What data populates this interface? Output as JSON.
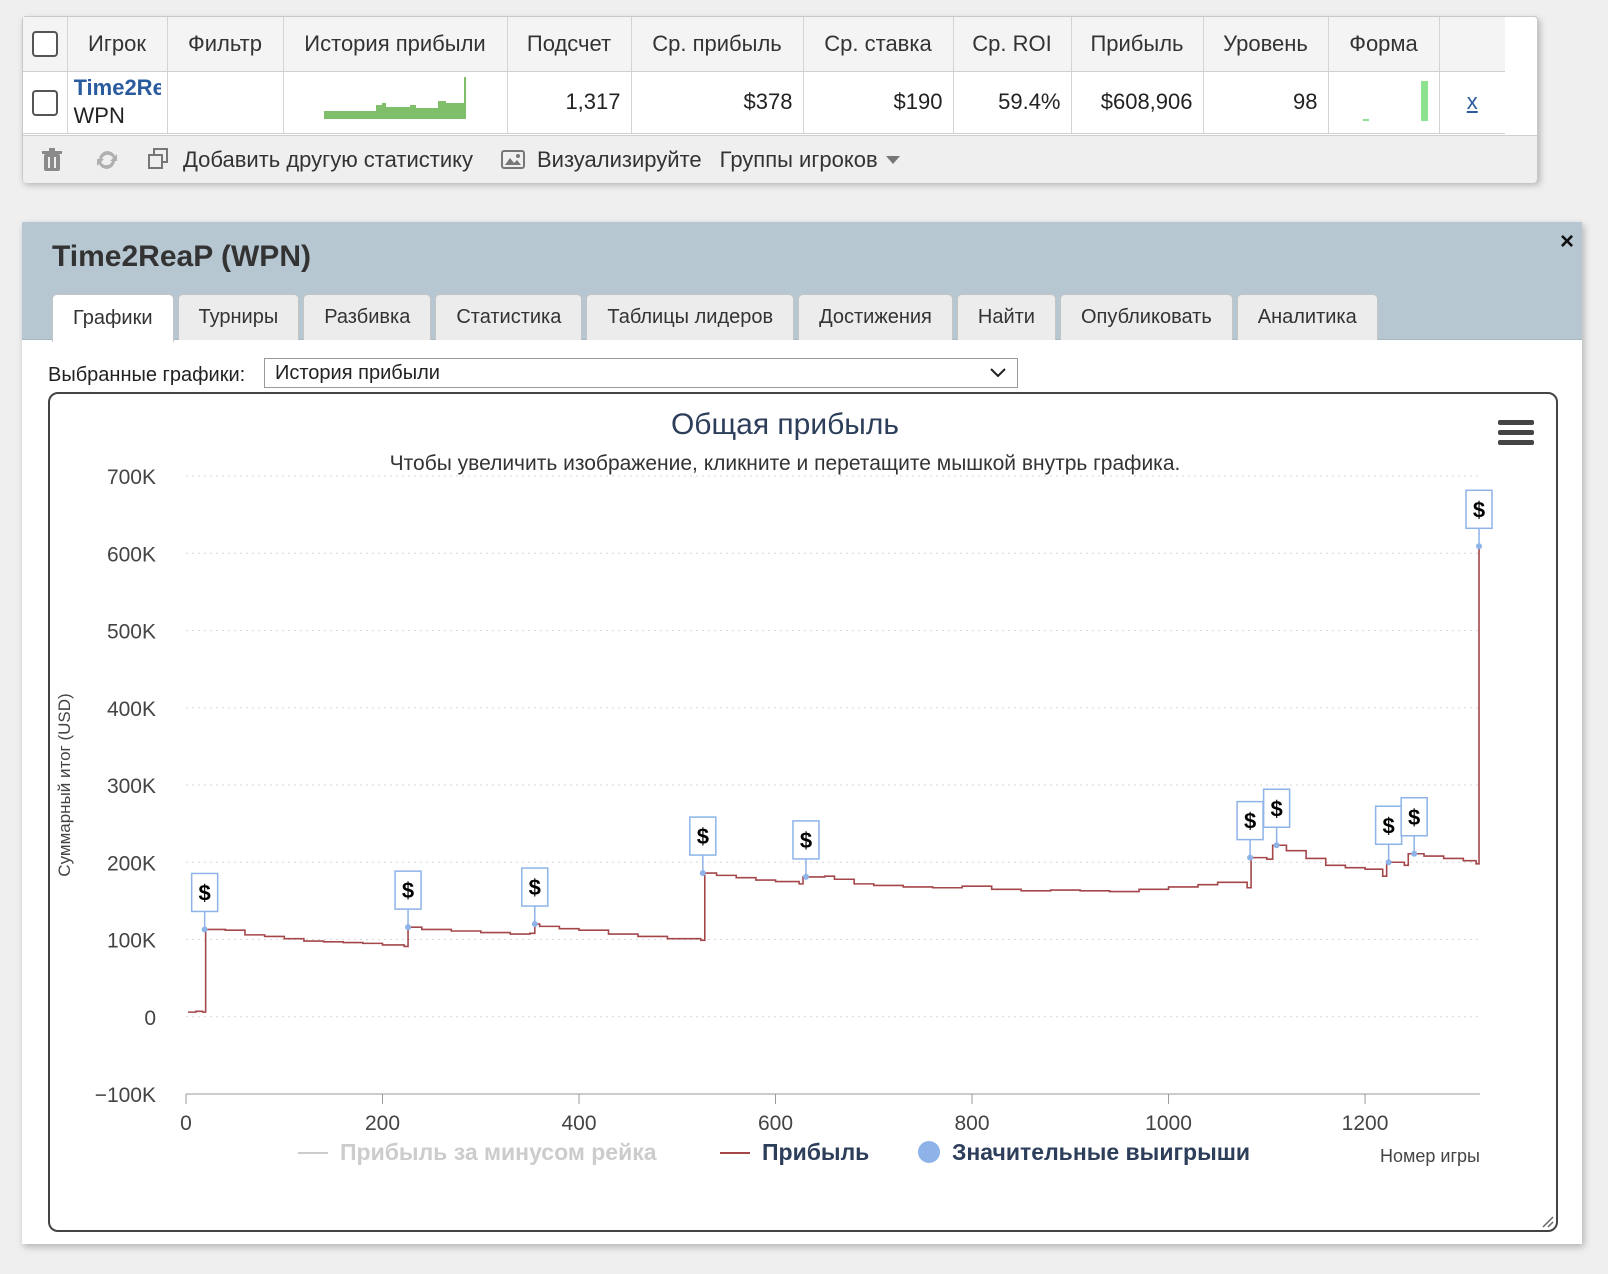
{
  "stats_table": {
    "headers": [
      "Игрок",
      "Фильтр",
      "История прибыли",
      "Подсчет",
      "Ср. прибыль",
      "Ср. ставка",
      "Ср. ROI",
      "Прибыль",
      "Уровень",
      "Форма"
    ],
    "row": {
      "player_name": "Time2ReaP",
      "network": "WPN",
      "filter": "",
      "count": "1,317",
      "avg_profit": "$378",
      "avg_stake": "$190",
      "avg_roi": "59.4%",
      "profit": "$608,906",
      "level": "98",
      "remove_link": "x"
    },
    "toolbar": {
      "delete_icon": "trash-icon",
      "refresh_icon": "refresh-icon",
      "add_stat_label": "Добавить другую статистику",
      "visualize_label": "Визуализируйте",
      "groups_label": "Группы игроков"
    }
  },
  "panel": {
    "title": "Time2ReaP (WPN)",
    "close_label": "×",
    "tabs": [
      {
        "label": "Графики",
        "active": true
      },
      {
        "label": "Турниры",
        "active": false
      },
      {
        "label": "Разбивка",
        "active": false
      },
      {
        "label": "Статистика",
        "active": false
      },
      {
        "label": "Таблицы лидеров",
        "active": false
      },
      {
        "label": "Достижения",
        "active": false
      },
      {
        "label": "Найти",
        "active": false
      },
      {
        "label": "Опубликовать",
        "active": false
      },
      {
        "label": "Аналитика",
        "active": false
      }
    ],
    "selector_label": "Выбранные графики:",
    "selector_value": "История прибыли"
  },
  "colors": {
    "profit_line": "#a3474b",
    "big_win_marker": "#8db3e8",
    "rake_line": "#cccccc",
    "title": "#2c3e5a",
    "tab_header_bg": "#b6c7d2",
    "sparkline": "#7fbf6a",
    "form_bar": "#8de28d"
  },
  "chart_data": {
    "type": "line",
    "title": "Общая прибыль",
    "subtitle": "Чтобы увеличить изображение, кликните и перетащите мышкой внутрь графика.",
    "xlabel": "Номер игры",
    "ylabel": "Суммарный итог (USD)",
    "xlim": [
      0,
      1317
    ],
    "ylim": [
      -100000,
      700000
    ],
    "x_ticks": [
      "0",
      "200",
      "400",
      "600",
      "800",
      "1000",
      "1200"
    ],
    "x_tick_values": [
      0,
      200,
      400,
      600,
      800,
      1000,
      1200
    ],
    "y_ticks": [
      "−100K",
      "0",
      "100K",
      "200K",
      "300K",
      "400K",
      "500K",
      "600K",
      "700K"
    ],
    "y_tick_values": [
      -100000,
      0,
      100000,
      200000,
      300000,
      400000,
      500000,
      600000,
      700000
    ],
    "grid": true,
    "legend": [
      {
        "name": "Прибыль за минусом рейка",
        "visible": false
      },
      {
        "name": "Прибыль",
        "visible": true
      },
      {
        "name": "Значительные выигрыши",
        "visible": true
      }
    ],
    "series": [
      {
        "name": "Прибыль",
        "x": [
          2,
          10,
          17,
          20,
          40,
          60,
          80,
          100,
          120,
          140,
          160,
          180,
          200,
          222,
          226,
          240,
          270,
          300,
          330,
          350,
          355,
          360,
          380,
          400,
          430,
          460,
          490,
          524,
          528,
          540,
          560,
          580,
          600,
          624,
          628,
          640,
          650,
          660,
          680,
          700,
          730,
          760,
          790,
          820,
          850,
          880,
          910,
          940,
          970,
          1000,
          1030,
          1050,
          1080,
          1084,
          1100,
          1106,
          1120,
          1140,
          1160,
          1180,
          1200,
          1218,
          1222,
          1240,
          1244,
          1260,
          1280,
          1300,
          1313,
          1316
        ],
        "values": [
          6000,
          7000,
          6000,
          113000,
          112000,
          106000,
          104000,
          101000,
          98000,
          97000,
          96000,
          95000,
          93000,
          91000,
          116000,
          113000,
          111000,
          109000,
          107000,
          108000,
          120000,
          117000,
          114000,
          112000,
          107000,
          104000,
          101000,
          99000,
          186000,
          183000,
          180000,
          177000,
          175000,
          172000,
          181000,
          181000,
          182000,
          178000,
          172000,
          170000,
          168000,
          167000,
          169000,
          165000,
          163000,
          164000,
          163000,
          162000,
          165000,
          168000,
          171000,
          174000,
          167000,
          206000,
          204000,
          222000,
          215000,
          205000,
          196000,
          193000,
          191000,
          182000,
          200000,
          196000,
          211000,
          208000,
          205000,
          202000,
          198000,
          609000
        ]
      },
      {
        "name": "Значительные выигрыши",
        "x": [
          19,
          226,
          355,
          526,
          631,
          1083,
          1110,
          1224,
          1250,
          1316
        ],
        "values": [
          113000,
          116000,
          120000,
          186000,
          181000,
          206000,
          222000,
          200000,
          211000,
          609000
        ],
        "label": "$"
      }
    ]
  }
}
